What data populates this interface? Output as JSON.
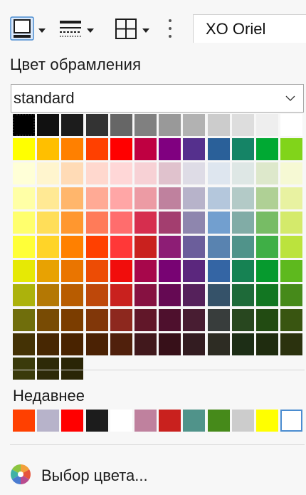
{
  "toolbar": {
    "font_name": "XO Oriel"
  },
  "panel": {
    "title": "Цвет обрамления",
    "palette_select_value": "standard",
    "palette": [
      [
        "#000000",
        "#111111",
        "#1c1c1c",
        "#333333",
        "#666666",
        "#808080",
        "#999999",
        "#b2b2b2",
        "#cccccc",
        "#dddddd",
        "#eeeeee",
        "#ffffff"
      ],
      [
        "#ffff00",
        "#ffbf00",
        "#ff8000",
        "#ff4000",
        "#ff0000",
        "#bf0041",
        "#800080",
        "#55308d",
        "#2a6099",
        "#158466",
        "#00a933",
        "#81d41a"
      ],
      [
        "#ffffd7",
        "#fff5ce",
        "#ffdbb6",
        "#ffd8ce",
        "#ffd7d7",
        "#f7d1d5",
        "#e0c2cd",
        "#dedce6",
        "#dee6ef",
        "#dee7e5",
        "#dde8cb",
        "#f6f9d4"
      ],
      [
        "#ffffa6",
        "#ffe994",
        "#ffb66c",
        "#ffaa95",
        "#ffa6a6",
        "#ec9ba4",
        "#bf819e",
        "#b7b3ca",
        "#b4c7dc",
        "#b3cac7",
        "#afd095",
        "#e8f2a1"
      ],
      [
        "#ffff6d",
        "#ffde59",
        "#ff972f",
        "#ff7b59",
        "#ff6d6d",
        "#d62e4e",
        "#a33e6f",
        "#8e86ae",
        "#729fcf",
        "#81aca6",
        "#77bc65",
        "#d4ea6b"
      ],
      [
        "#ffff38",
        "#ffd428",
        "#ff8000",
        "#ff4000",
        "#ff3838",
        "#c9211e",
        "#8d1d75",
        "#6b5e9b",
        "#5983b0",
        "#50938a",
        "#3faf46",
        "#bbe33d"
      ],
      [
        "#e6e905",
        "#e8a202",
        "#ea7500",
        "#ed4c05",
        "#f10d0c",
        "#a7074b",
        "#780373",
        "#5b277d",
        "#3465a4",
        "#168253",
        "#069a2e",
        "#5eb91e"
      ],
      [
        "#acb20c",
        "#b47804",
        "#b85c00",
        "#be480a",
        "#c9211e",
        "#861141",
        "#650953",
        "#55215b",
        "#355269",
        "#1e6a39",
        "#127622",
        "#468a1a"
      ],
      [
        "#706e0c",
        "#784b04",
        "#7b3d00",
        "#813709",
        "#8d281e",
        "#611729",
        "#4e102d",
        "#481d32",
        "#383d3c",
        "#28471f",
        "#224b12",
        "#395511"
      ],
      [
        "#443205",
        "#472702",
        "#492300",
        "#4b2204",
        "#50200c",
        "#41181c",
        "#371019",
        "#331c21",
        "#2d2c23",
        "#1d2e16",
        "#1f2c0f",
        "#2b320e"
      ],
      [
        "#3a3a0b",
        "#2e2a08",
        "#2a2506"
      ]
    ],
    "selected_color": "#000000",
    "recent_title": "Недавнее",
    "recent_colors": [
      "#ff4000",
      "#b7b3ca",
      "#ff0000",
      "#1c1c1c",
      "#ffffff",
      "#bf819e",
      "#c9211e",
      "#50938a",
      "#468a1a",
      "#cccccc",
      "#ffff00",
      "#f0f6fc"
    ],
    "picker_label": "Выбор цвета..."
  }
}
